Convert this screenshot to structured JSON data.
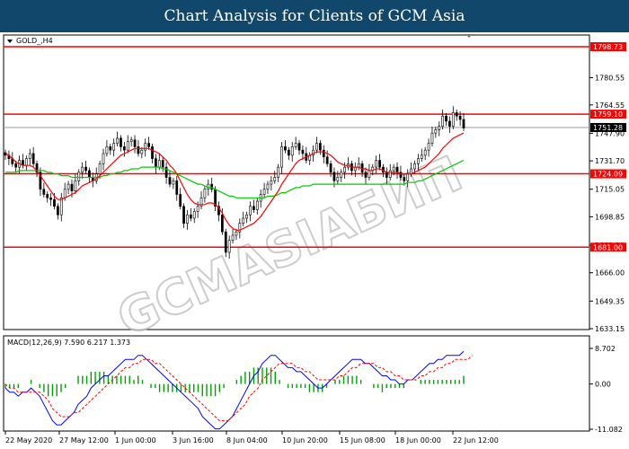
{
  "header": {
    "title": "Chart Analysis for Clients of GCM Asia"
  },
  "colors": {
    "header_bg": "#10476b",
    "level_line": "#ff0000",
    "ma_fast": "#ff0000",
    "ma_slow": "#00cc00",
    "candle_up": "#00aa00",
    "candle_down": "#ff0000",
    "macd_line": "#0000ff",
    "signal_line": "#ff0000",
    "histogram": "#00a000"
  },
  "watermark": {
    "text": "GCMASIAБИП"
  },
  "chart_data": [
    {
      "type": "candlestick",
      "symbol_label": "GOLD_,H4",
      "ylim": [
        1633.15,
        1798.73
      ],
      "y_ticks": [
        "1780.55",
        "1764.55",
        "1747.90",
        "1731.70",
        "1715.05",
        "1698.85",
        "1682.20",
        "1666.00",
        "1649.35",
        "1633.15"
      ],
      "x_ticks": [
        "22 May 2020",
        "27 May 12:00",
        "1 Jun 00:00",
        "3 Jun 16:00",
        "8 Jun 04:00",
        "10 Jun 20:00",
        "15 Jun 08:00",
        "18 Jun 00:00",
        "22 Jun 12:00"
      ],
      "levels": [
        {
          "value": 1798.73,
          "label": "1798.73"
        },
        {
          "value": 1759.1,
          "label": "1759.10"
        },
        {
          "value": 1724.09,
          "label": "1724.09"
        },
        {
          "value": 1681.0,
          "label": "1681.00"
        }
      ],
      "current_price": {
        "value": 1751.28,
        "label": "1751.28"
      },
      "close": [
        1735,
        1733,
        1730,
        1728,
        1732,
        1729,
        1733,
        1736,
        1730,
        1725,
        1715,
        1712,
        1710,
        1709,
        1705,
        1700,
        1710,
        1715,
        1718,
        1714,
        1720,
        1725,
        1728,
        1726,
        1722,
        1720,
        1724,
        1730,
        1736,
        1740,
        1738,
        1742,
        1745,
        1740,
        1738,
        1743,
        1744,
        1740,
        1736,
        1738,
        1742,
        1740,
        1733,
        1728,
        1732,
        1728,
        1722,
        1718,
        1720,
        1712,
        1705,
        1695,
        1700,
        1698,
        1702,
        1705,
        1710,
        1715,
        1718,
        1715,
        1705,
        1700,
        1690,
        1678,
        1685,
        1688,
        1690,
        1695,
        1698,
        1700,
        1705,
        1703,
        1708,
        1712,
        1715,
        1718,
        1720,
        1722,
        1728,
        1740,
        1738,
        1735,
        1740,
        1742,
        1738,
        1736,
        1732,
        1735,
        1738,
        1742,
        1738,
        1734,
        1730,
        1725,
        1720,
        1722,
        1725,
        1728,
        1730,
        1726,
        1728,
        1730,
        1725,
        1722,
        1726,
        1728,
        1732,
        1728,
        1725,
        1722,
        1726,
        1728,
        1725,
        1722,
        1720,
        1724,
        1727,
        1730,
        1733,
        1735,
        1738,
        1742,
        1748,
        1750,
        1752,
        1758,
        1755,
        1752,
        1760,
        1758,
        1756,
        1751
      ],
      "ma_fast": [
        1736,
        1735,
        1733,
        1731,
        1730,
        1729,
        1729,
        1729,
        1728,
        1726,
        1723,
        1720,
        1717,
        1714,
        1711,
        1709,
        1709,
        1710,
        1711,
        1712,
        1713,
        1715,
        1717,
        1718,
        1719,
        1720,
        1721,
        1723,
        1725,
        1727,
        1729,
        1731,
        1733,
        1735,
        1736,
        1737,
        1738,
        1739,
        1739,
        1739,
        1739,
        1739,
        1738,
        1737,
        1736,
        1734,
        1732,
        1729,
        1727,
        1724,
        1720,
        1716,
        1712,
        1709,
        1707,
        1706,
        1706,
        1706,
        1707,
        1707,
        1706,
        1704,
        1701,
        1697,
        1694,
        1692,
        1691,
        1691,
        1692,
        1693,
        1694,
        1695,
        1697,
        1699,
        1702,
        1705,
        1708,
        1711,
        1714,
        1718,
        1721,
        1724,
        1727,
        1730,
        1732,
        1733,
        1734,
        1735,
        1736,
        1737,
        1737,
        1737,
        1736,
        1735,
        1733,
        1731,
        1730,
        1729,
        1729,
        1728,
        1728,
        1728,
        1727,
        1727,
        1726,
        1726,
        1727,
        1727,
        1726,
        1725,
        1725,
        1725,
        1725,
        1724,
        1724,
        1724,
        1724,
        1725,
        1726,
        1727,
        1728,
        1730,
        1732,
        1734,
        1736,
        1739,
        1741,
        1743,
        1745,
        1746,
        1747,
        1748
      ],
      "ma_slow": [
        1725,
        1725,
        1725,
        1725,
        1726,
        1726,
        1726,
        1726,
        1726,
        1726,
        1726,
        1726,
        1725,
        1725,
        1724,
        1724,
        1723,
        1723,
        1723,
        1722,
        1722,
        1722,
        1722,
        1722,
        1722,
        1722,
        1722,
        1722,
        1723,
        1723,
        1724,
        1724,
        1725,
        1725,
        1726,
        1726,
        1727,
        1727,
        1727,
        1728,
        1728,
        1728,
        1728,
        1728,
        1728,
        1727,
        1727,
        1726,
        1725,
        1724,
        1723,
        1722,
        1721,
        1720,
        1719,
        1718,
        1718,
        1717,
        1716,
        1716,
        1715,
        1714,
        1713,
        1712,
        1711,
        1711,
        1710,
        1710,
        1710,
        1710,
        1710,
        1710,
        1710,
        1710,
        1710,
        1711,
        1711,
        1711,
        1712,
        1713,
        1713,
        1714,
        1715,
        1716,
        1716,
        1717,
        1717,
        1717,
        1718,
        1718,
        1718,
        1718,
        1718,
        1718,
        1718,
        1718,
        1718,
        1718,
        1718,
        1718,
        1718,
        1718,
        1718,
        1718,
        1718,
        1718,
        1718,
        1718,
        1718,
        1718,
        1718,
        1718,
        1718,
        1718,
        1718,
        1719,
        1719,
        1719,
        1720,
        1720,
        1721,
        1722,
        1723,
        1724,
        1725,
        1726,
        1727,
        1728,
        1729,
        1730,
        1731,
        1732
      ]
    },
    {
      "type": "macd",
      "label": "MACD(12,26,9) 7.590 6.217 1.373",
      "ylim": [
        -11.082,
        8.702
      ],
      "y_ticks": [
        "8.702",
        "0.00",
        "-11.082"
      ],
      "macd": [
        -1,
        -2,
        -2,
        -3,
        -2,
        -2,
        -1,
        -2,
        -3,
        -5,
        -7,
        -9,
        -10,
        -10,
        -9,
        -8,
        -7,
        -5,
        -4,
        -3,
        -1,
        0,
        1,
        2,
        2,
        3,
        4,
        5,
        6,
        6,
        6,
        7,
        7,
        6,
        5,
        4,
        3,
        2,
        1,
        0,
        -1,
        -2,
        -3,
        -4,
        -5,
        -6,
        -8,
        -9,
        -10,
        -11,
        -11,
        -10,
        -9,
        -8,
        -6,
        -4,
        -2,
        0,
        2,
        3,
        5,
        6,
        7,
        7,
        6,
        5,
        4,
        4,
        3,
        3,
        2,
        1,
        0,
        -1,
        -1,
        0,
        1,
        2,
        3,
        4,
        5,
        6,
        6,
        6,
        5,
        5,
        4,
        3,
        2,
        2,
        1,
        1,
        0,
        0,
        1,
        1,
        2,
        3,
        4,
        5,
        5,
        6,
        6,
        7,
        7,
        7,
        7,
        8
      ],
      "signal": [
        0,
        -1,
        -1,
        -2,
        -2,
        -2,
        -2,
        -2,
        -2,
        -3,
        -4,
        -6,
        -7,
        -8,
        -8,
        -8,
        -7,
        -7,
        -6,
        -5,
        -4,
        -3,
        -2,
        -1,
        0,
        1,
        2,
        3,
        4,
        4,
        5,
        5,
        6,
        6,
        6,
        5,
        5,
        4,
        3,
        2,
        1,
        0,
        -1,
        -2,
        -3,
        -4,
        -5,
        -6,
        -7,
        -8,
        -9,
        -9,
        -9,
        -8,
        -7,
        -6,
        -5,
        -3,
        -2,
        -1,
        1,
        2,
        3,
        4,
        5,
        5,
        5,
        5,
        4,
        4,
        3,
        3,
        2,
        1,
        1,
        1,
        1,
        1,
        2,
        2,
        3,
        4,
        4,
        5,
        5,
        5,
        5,
        4,
        4,
        3,
        3,
        2,
        2,
        1,
        1,
        1,
        1,
        2,
        2,
        3,
        3,
        4,
        4,
        5,
        5,
        6,
        6,
        6,
        6,
        7
      ],
      "histogram": [
        -1,
        -1,
        -1,
        -1,
        0,
        0,
        1,
        0,
        -1,
        -2,
        -3,
        -3,
        -3,
        -2,
        -1,
        0,
        0,
        2,
        2,
        2,
        3,
        3,
        3,
        3,
        2,
        2,
        2,
        2,
        2,
        2,
        1,
        2,
        1,
        0,
        -1,
        -1,
        -2,
        -2,
        -2,
        -2,
        -2,
        -2,
        -2,
        -2,
        -2,
        -2,
        -3,
        -3,
        -3,
        -3,
        -2,
        -1,
        0,
        0,
        1,
        2,
        3,
        3,
        4,
        4,
        4,
        4,
        4,
        3,
        1,
        0,
        -1,
        -1,
        -1,
        -1,
        -1,
        -2,
        -2,
        -2,
        -2,
        -1,
        0,
        1,
        1,
        2,
        2,
        2,
        2,
        1,
        0,
        0,
        -1,
        -1,
        -2,
        -1,
        -1,
        -1,
        -1,
        -1,
        0,
        0,
        0,
        1,
        1,
        1,
        1,
        1,
        1,
        1,
        1,
        1,
        1,
        2
      ]
    }
  ]
}
